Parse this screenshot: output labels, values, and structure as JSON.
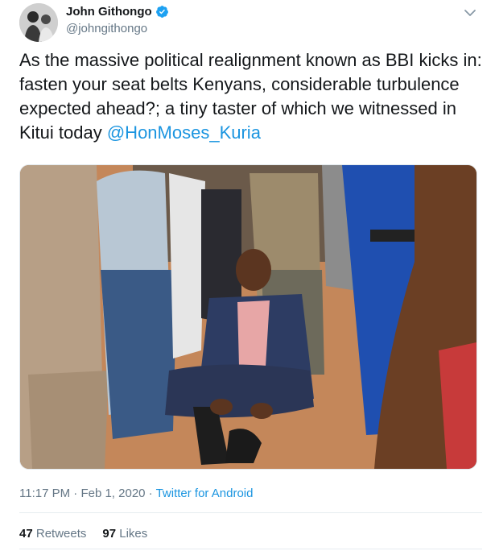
{
  "author": {
    "display_name": "John Githongo",
    "handle": "@johngithongo",
    "verified": true,
    "avatar_icon": "profile-photo"
  },
  "tweet": {
    "text": "As the massive political  realignment known as BBI kicks in: fasten your seat belts Kenyans, considerable turbulence expected ahead?; a tiny taster of which we witnessed in Kitui today ",
    "mention": "@HonMoses_Kuria"
  },
  "meta": {
    "time": "11:17 PM",
    "separator": "·",
    "date": "Feb 1, 2020",
    "source": "Twitter for Android"
  },
  "stats": {
    "retweets_count": "47",
    "retweets_label": "Retweets",
    "likes_count": "97",
    "likes_label": "Likes"
  },
  "colors": {
    "link": "#1b95e0",
    "secondary_text": "#657786",
    "verified_badge": "#1da1f2"
  }
}
